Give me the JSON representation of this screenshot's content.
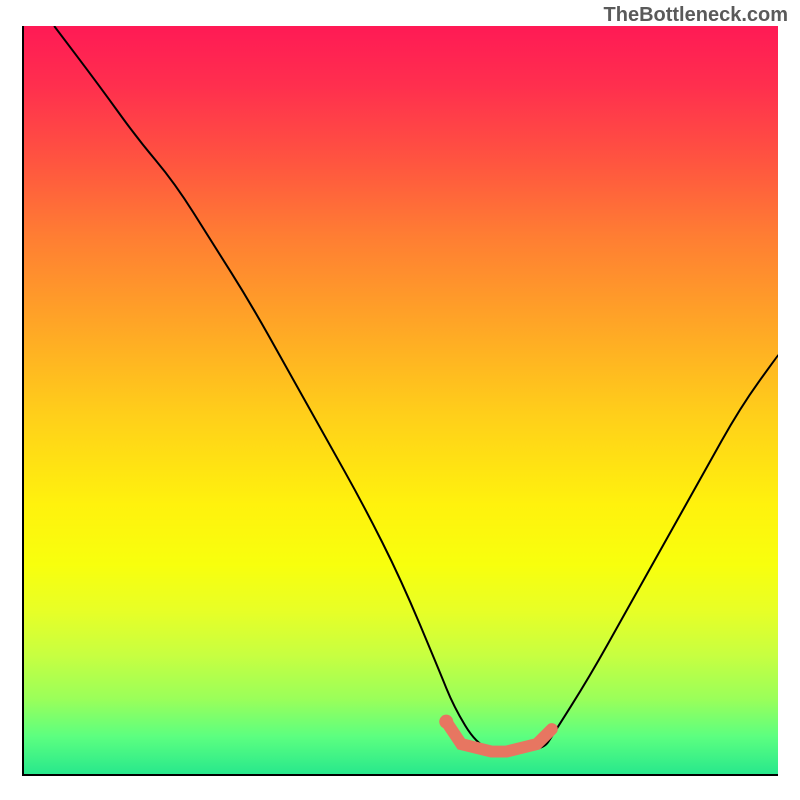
{
  "watermark": "TheBottleneck.com",
  "chart_data": {
    "type": "line",
    "title": "",
    "xlabel": "",
    "ylabel": "",
    "xlim": [
      0,
      100
    ],
    "ylim": [
      0,
      100
    ],
    "grid": false,
    "background": "red-yellow-green vertical gradient (red top, green bottom)",
    "series": [
      {
        "name": "bottleneck-curve",
        "description": "V-shaped black curve descending from top-left to a minimum near x≈63, rising to the right",
        "x": [
          4,
          10,
          15,
          20,
          25,
          30,
          35,
          40,
          45,
          50,
          55,
          57,
          60,
          63,
          66,
          69,
          70,
          75,
          80,
          85,
          90,
          95,
          100
        ],
        "values": [
          100,
          92,
          85,
          79,
          71,
          63,
          54,
          45,
          36,
          26,
          14,
          9,
          4,
          3,
          3,
          3.5,
          5,
          13,
          22,
          31,
          40,
          49,
          56
        ]
      },
      {
        "name": "optimal-highlight",
        "description": "Thick salmon segment marking the valley floor, with a dot at the left end",
        "x": [
          56,
          58,
          60,
          62,
          64,
          66,
          68,
          70
        ],
        "values": [
          7,
          4,
          3.5,
          3,
          3,
          3.5,
          4,
          6
        ]
      }
    ],
    "colors": {
      "curve": "#000000",
      "highlight": "#e77661",
      "gradient_top": "#ff1a55",
      "gradient_mid": "#ffe600",
      "gradient_bottom": "#28e88c"
    }
  }
}
